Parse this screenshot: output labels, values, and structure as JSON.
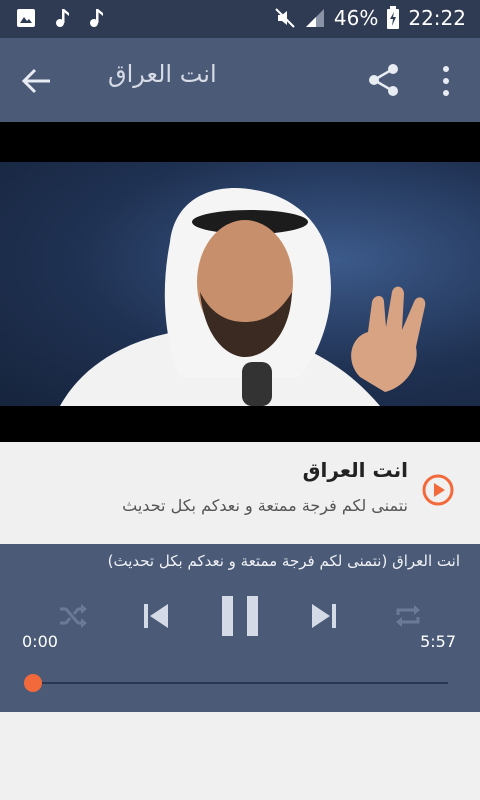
{
  "status_bar": {
    "battery_percent": "46%",
    "time": "22:22",
    "icons": [
      "image-icon",
      "music-note-icon",
      "music-note-icon",
      "mute-icon",
      "signal-icon",
      "battery-charging-icon"
    ]
  },
  "app_bar": {
    "title": "انت العراق",
    "back_icon": "arrow-back-icon",
    "share_icon": "share-icon",
    "more_icon": "more-vert-icon"
  },
  "song": {
    "title": "انت العراق",
    "description": "نتمنى لكم فرجة ممتعة و نعدكم بكل تحديث"
  },
  "player": {
    "now_playing": "انت العراق (نتمنى لكم فرجة ممتعة و نعدكم بكل تحديث)",
    "time_current": "0:00",
    "time_total": "5:57",
    "progress": 0.0,
    "controls": [
      "shuffle-icon",
      "skip-previous-icon",
      "pause-icon",
      "skip-next-icon",
      "repeat-icon"
    ]
  },
  "colors": {
    "status_bar": "#2e3b53",
    "toolbar": "#4a5a77",
    "accent": "#f26a3b",
    "background": "#f0f0f0"
  }
}
